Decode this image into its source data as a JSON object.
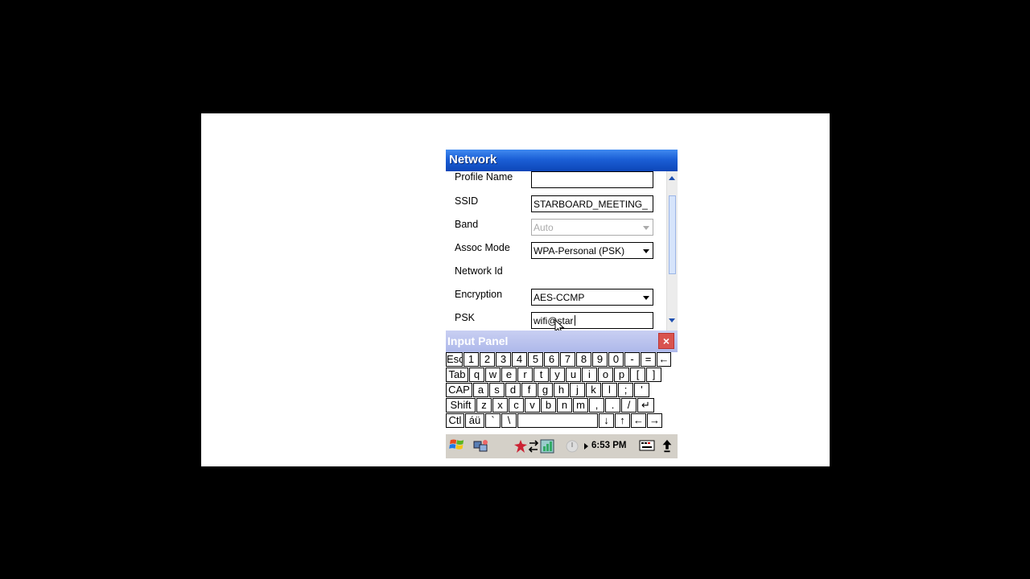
{
  "window": {
    "title": "Network"
  },
  "form": {
    "profile_name": {
      "label": "Profile Name",
      "value": ""
    },
    "ssid": {
      "label": "SSID",
      "value": "STARBOARD_MEETING_"
    },
    "band": {
      "label": "Band",
      "value": "Auto"
    },
    "assoc_mode": {
      "label": "Assoc Mode",
      "value": "WPA-Personal (PSK)"
    },
    "network_id": {
      "label": "Network Id"
    },
    "encryption": {
      "label": "Encryption",
      "value": "AES-CCMP"
    },
    "psk": {
      "label": "PSK",
      "value": "wifi@star"
    }
  },
  "input_panel": {
    "title": "Input Panel",
    "close_label": "×",
    "rows": [
      [
        "Esc",
        "1",
        "2",
        "3",
        "4",
        "5",
        "6",
        "7",
        "8",
        "9",
        "0",
        "-",
        "=",
        "←"
      ],
      [
        "Tab",
        "q",
        "w",
        "e",
        "r",
        "t",
        "y",
        "u",
        "i",
        "o",
        "p",
        "[",
        "]"
      ],
      [
        "CAP",
        "a",
        "s",
        "d",
        "f",
        "g",
        "h",
        "j",
        "k",
        "l",
        ";",
        "'"
      ],
      [
        "Shift",
        "z",
        "x",
        "c",
        "v",
        "b",
        "n",
        "m",
        ",",
        ".",
        "/",
        "↵"
      ],
      [
        "Ctl",
        "áü",
        "`",
        "\\",
        " ",
        "↓",
        "↑",
        "←",
        "→"
      ]
    ]
  },
  "taskbar": {
    "clock": "6:53 PM",
    "icons": [
      "start-icon",
      "connection-icon",
      "security-icon",
      "network-status-icon",
      "signal-icon",
      "battery-icon",
      "keyboard-icon",
      "up-arrow-icon"
    ]
  },
  "colors": {
    "title_bar": "#1b5fd6",
    "input_panel_title": "#aeb8ea",
    "close_button": "#d9534f",
    "taskbar": "#d4d0c8"
  }
}
